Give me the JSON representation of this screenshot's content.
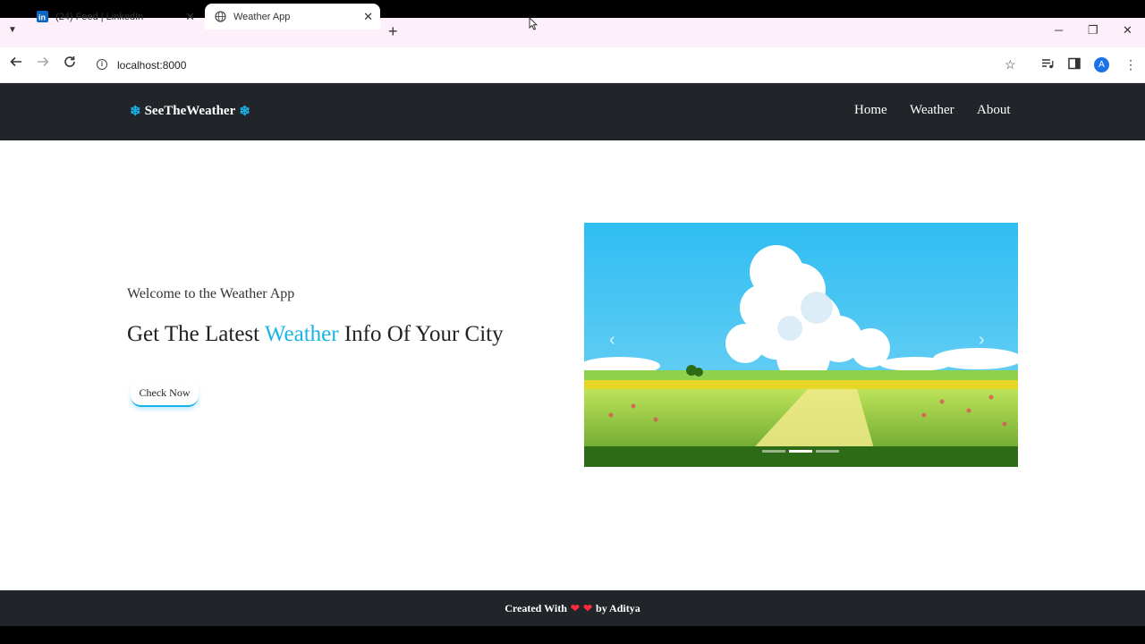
{
  "browser": {
    "tabs": [
      {
        "label": "(24) Feed | LinkedIn",
        "icon": "linkedin-icon",
        "active": false
      },
      {
        "label": "Weather App",
        "icon": "globe-icon",
        "active": true
      }
    ],
    "close_glyph": "✕",
    "new_tab_glyph": "+",
    "url": "localhost:8000",
    "avatar_letter": "A",
    "window_controls": {
      "minimize": "─",
      "restore": "❐",
      "close": "✕"
    }
  },
  "site": {
    "brand": "SeeTheWeather",
    "brand_icon_glyph": "❄",
    "nav": [
      "Home",
      "Weather",
      "About"
    ]
  },
  "hero": {
    "welcome": "Welcome to the Weather App",
    "headline_before": "Get The Latest ",
    "headline_accent": "Weather",
    "headline_after": " Info Of Your City",
    "cta": "Check Now",
    "accent_color": "#19b3e6"
  },
  "carousel": {
    "prev_glyph": "‹",
    "next_glyph": "›",
    "slide_count": 3,
    "active_index": 1
  },
  "footer": {
    "before": "Created With",
    "heart_glyph": "❤",
    "after": "by Aditya"
  },
  "colors": {
    "navbar": "#212529",
    "accent": "#19b3e6",
    "heart": "#ff2a3d"
  }
}
